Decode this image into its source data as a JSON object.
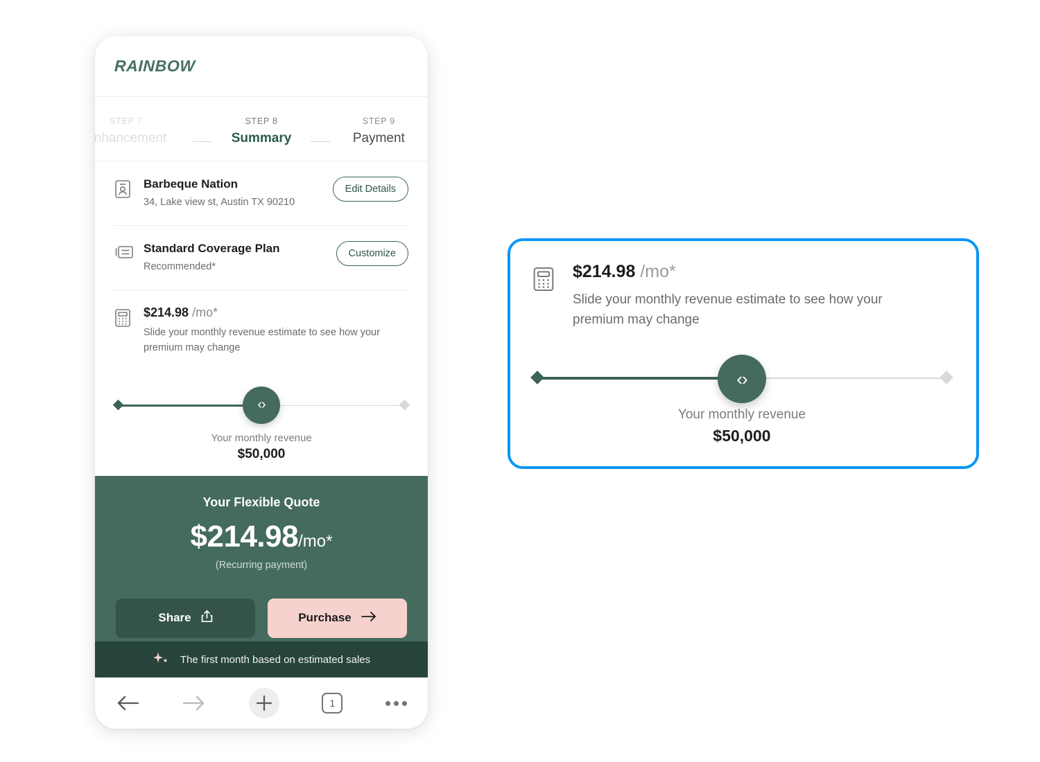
{
  "brand": {
    "logo_text": "RAINBOW",
    "accent_green": "#456b5e",
    "accent_pink": "#f6d2ce",
    "highlight_blue": "#0c96f5"
  },
  "stepper": {
    "steps": [
      {
        "number_label": "STEP 7",
        "label": "Enhancement",
        "state": "past"
      },
      {
        "number_label": "STEP 8",
        "label": "Summary",
        "state": "active"
      },
      {
        "number_label": "STEP 9",
        "label": "Payment",
        "state": "upcoming"
      }
    ]
  },
  "rows": {
    "business": {
      "icon": "contact-card-icon",
      "title": "Barbeque Nation",
      "address": "34, Lake view st, Austin TX 90210",
      "action_label": "Edit Details"
    },
    "plan": {
      "icon": "article-icon",
      "title": "Standard Coverage Plan",
      "subtitle": "Recommended*",
      "action_label": "Customize"
    },
    "estimator": {
      "icon": "calculator-icon",
      "price": "$214.98",
      "price_unit": "/mo*",
      "description": "Slide your monthly revenue estimate to see how your premium may change"
    }
  },
  "slider": {
    "revenue_caption": "Your monthly revenue",
    "revenue_value": "$50,000",
    "fill_percent": 48,
    "handle_glyph": "‹›"
  },
  "quote": {
    "title": "Your Flexible Quote",
    "amount": "$214.98",
    "unit": "/mo*",
    "note": "(Recurring payment)",
    "share_label": "Share",
    "purchase_label": "Purchase"
  },
  "banner": {
    "icon": "sparkle-icon",
    "text": "The first month based on estimated sales"
  },
  "browser_bar": {
    "back_icon": "arrow-left-icon",
    "forward_icon": "arrow-right-icon",
    "new_tab_icon": "plus-icon",
    "tab_count": "1",
    "more_icon": "ellipsis-icon"
  },
  "callout": {
    "icon": "calculator-icon",
    "price": "$214.98",
    "price_unit": "/mo*",
    "description": "Slide your monthly revenue estimate to see how your premium may change",
    "revenue_caption": "Your monthly revenue",
    "revenue_value": "$50,000",
    "handle_glyph": "‹›"
  }
}
